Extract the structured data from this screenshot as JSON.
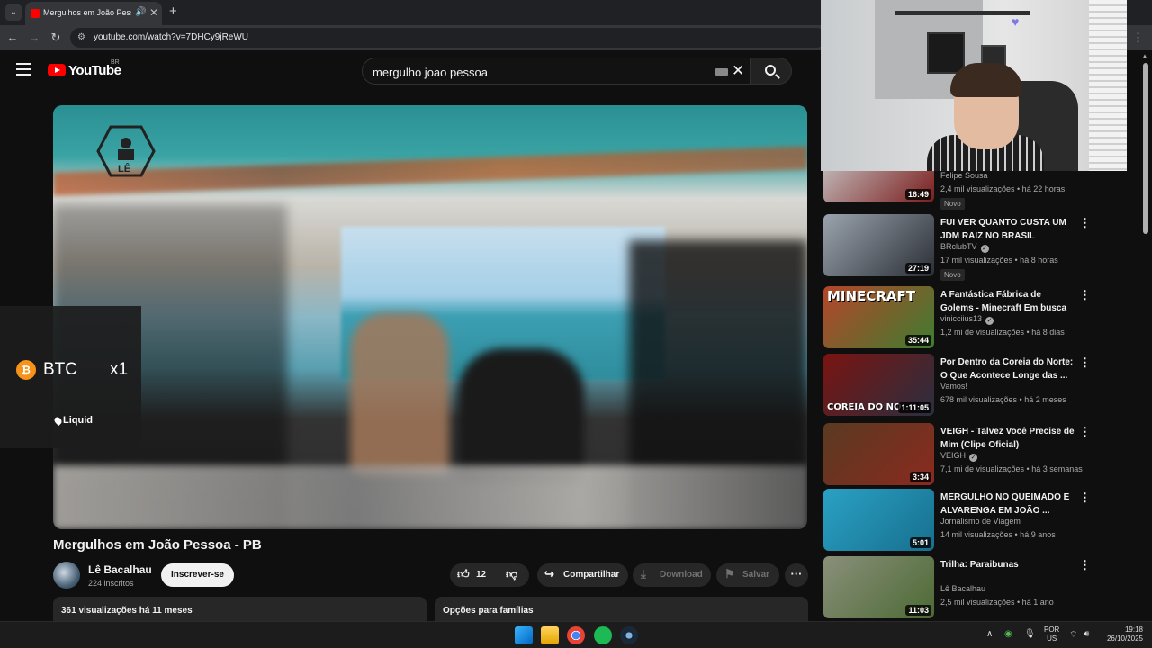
{
  "browser": {
    "tab_title": "Mergulhos em João Pessoa",
    "url": "youtube.com/watch?v=7DHCy9jReWU",
    "new_tab_symbol": "+",
    "tab_close_symbol": "✕"
  },
  "header": {
    "logo_text": "YouTube",
    "country_code": "BR",
    "search_query": "mergulho joao pessoa"
  },
  "ad": {
    "ticker": "BTC",
    "multiplier": "x1",
    "brand": "Liquid",
    "coin_symbol": "₿"
  },
  "video": {
    "title": "Mergulhos em João Pessoa - PB",
    "channel": "Lê Bacalhau",
    "subscribers": "224 inscritos",
    "subscribe_label": "Inscrever-se",
    "likes": "12",
    "share_label": "Compartilhar",
    "download_label": "Download",
    "save_label": "Salvar",
    "views_date": "361 visualizações  há 11 meses",
    "family_label": "Opções para famílias"
  },
  "recommendations": [
    {
      "title": "",
      "channel": "Felipe Sousa",
      "meta": "2,4 mil visualizações • há 22 horas",
      "badge": "Novo",
      "duration": "16:49",
      "verified": false,
      "colors": [
        "#c9c9c9",
        "#7a1c1c"
      ]
    },
    {
      "title": "FUI VER QUANTO CUSTA UM JDM RAIZ NO BRASIL",
      "channel": "BRclubTV",
      "meta": "17 mil visualizações • há 8 horas",
      "badge": "Novo",
      "duration": "27:19",
      "verified": true,
      "colors": [
        "#9aa3ad",
        "#2b2f36"
      ]
    },
    {
      "title": "A Fantástica Fábrica de Golems - Minecraft Em busca da casa ...",
      "channel": "vinicciius13",
      "meta": "1,2 mi de visualizações • há 8 dias",
      "badge": "",
      "duration": "35:44",
      "verified": true,
      "colors": [
        "#b5452a",
        "#3e7d2f"
      ],
      "thumb_text": "MINECRAFT"
    },
    {
      "title": "Por Dentro da Coreia do Norte: O Que Acontece Longe das ...",
      "channel": "Vamos!",
      "meta": "678 mil visualizações • há 2 meses",
      "badge": "",
      "duration": "1:11:05",
      "verified": false,
      "colors": [
        "#7a1410",
        "#2a2f40"
      ],
      "thumb_text": "COREIA DO NO"
    },
    {
      "title": "VEIGH - Talvez Você Precise de Mim (Clipe Oficial)",
      "channel": "VEIGH",
      "meta": "7,1 mi de visualizações • há 3 semanas",
      "badge": "",
      "duration": "3:34",
      "verified": true,
      "colors": [
        "#5a3a22",
        "#8a2a1e"
      ]
    },
    {
      "title": "MERGULHO NO QUEIMADO E ALVARENGA EM JOÃO ...",
      "channel": "Jornalismo de Viagem",
      "meta": "14 mil visualizações • há 9 anos",
      "badge": "",
      "duration": "5:01",
      "verified": false,
      "colors": [
        "#2aa1c4",
        "#176f8e"
      ]
    },
    {
      "title": "Trilha: Paraibunas",
      "channel": "Lê Bacalhau",
      "meta": "2,5 mil visualizações • há 1 ano",
      "badge": "",
      "duration": "11:03",
      "verified": false,
      "colors": [
        "#8a8f7a",
        "#4c6a34"
      ]
    }
  ],
  "taskbar": {
    "lang_top": "POR",
    "lang_bottom": "US",
    "time": "19:18",
    "date": "26/10/2025"
  }
}
